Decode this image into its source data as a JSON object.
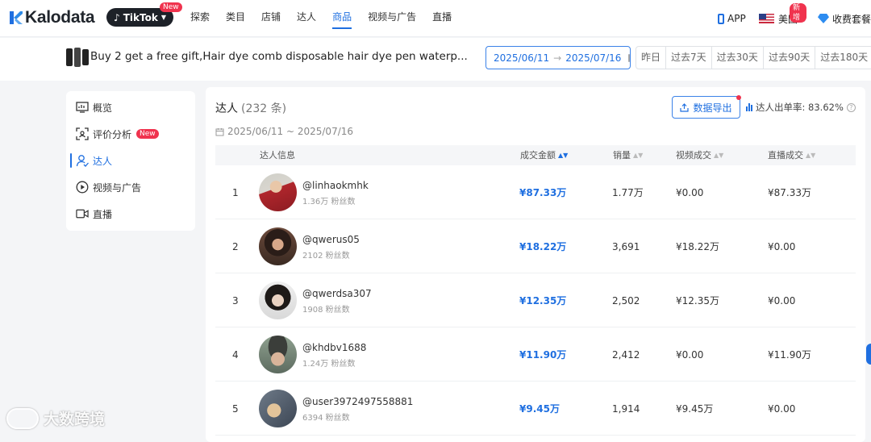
{
  "brand": {
    "name": "Kalodata"
  },
  "platform": {
    "label": "TikTok",
    "badge": "New"
  },
  "nav": [
    {
      "label": "探索",
      "active": false
    },
    {
      "label": "类目",
      "active": false
    },
    {
      "label": "店铺",
      "active": false
    },
    {
      "label": "达人",
      "active": false
    },
    {
      "label": "商品",
      "active": true
    },
    {
      "label": "视频与广告",
      "active": false
    },
    {
      "label": "直播",
      "active": false
    }
  ],
  "top_right": {
    "app": "APP",
    "region": "美国",
    "region_badge": "新增",
    "pricing": "收费套餐"
  },
  "product": {
    "title": "Buy 2 get a free gift,Hair dye comb disposable hair dye pen waterp..."
  },
  "date_range": {
    "start": "2025/06/11",
    "arrow": "→",
    "end": "2025/07/16"
  },
  "quick_ranges": [
    "昨日",
    "过去7天",
    "过去30天",
    "过去90天",
    "过去180天"
  ],
  "sidebar": [
    {
      "label": "概览",
      "icon": "overview-chart-icon",
      "active": false,
      "badge": ""
    },
    {
      "label": "评价分析",
      "icon": "review-analysis-icon",
      "active": false,
      "badge": "New"
    },
    {
      "label": "达人",
      "icon": "creator-icon",
      "active": true,
      "badge": ""
    },
    {
      "label": "视频与广告",
      "icon": "play-circle-icon",
      "active": false,
      "badge": ""
    },
    {
      "label": "直播",
      "icon": "live-camera-icon",
      "active": false,
      "badge": ""
    }
  ],
  "panel": {
    "title": "达人",
    "count": "(232 条)",
    "export_label": "数据导出",
    "rate_label": "达人出单率: 83.62%",
    "date_text": "2025/06/11 ~ 2025/07/16"
  },
  "table": {
    "headers": {
      "info": "达人信息",
      "gmv": "成交金额",
      "sales": "销量",
      "video": "视频成交",
      "live": "直播成交"
    },
    "rows": [
      {
        "rank": "1",
        "handle": "@linhaokmhk",
        "fans": "1.36万 粉丝数",
        "gmv": "¥87.33万",
        "sales": "1.77万",
        "video": "¥0.00",
        "live": "¥87.33万"
      },
      {
        "rank": "2",
        "handle": "@qwerus05",
        "fans": "2102 粉丝数",
        "gmv": "¥18.22万",
        "sales": "3,691",
        "video": "¥18.22万",
        "live": "¥0.00"
      },
      {
        "rank": "3",
        "handle": "@qwerdsa307",
        "fans": "1908 粉丝数",
        "gmv": "¥12.35万",
        "sales": "2,502",
        "video": "¥12.35万",
        "live": "¥0.00"
      },
      {
        "rank": "4",
        "handle": "@khdbv1688",
        "fans": "1.24万 粉丝数",
        "gmv": "¥11.90万",
        "sales": "2,412",
        "video": "¥0.00",
        "live": "¥11.90万"
      },
      {
        "rank": "5",
        "handle": "@user3972497558881",
        "fans": "6394 粉丝数",
        "gmv": "¥9.45万",
        "sales": "1,914",
        "video": "¥9.45万",
        "live": "¥0.00"
      }
    ]
  },
  "watermark": {
    "text": "大数跨境"
  },
  "colors": {
    "accent": "#1f6fe0",
    "badge": "#f0334e",
    "text": "#222222"
  }
}
